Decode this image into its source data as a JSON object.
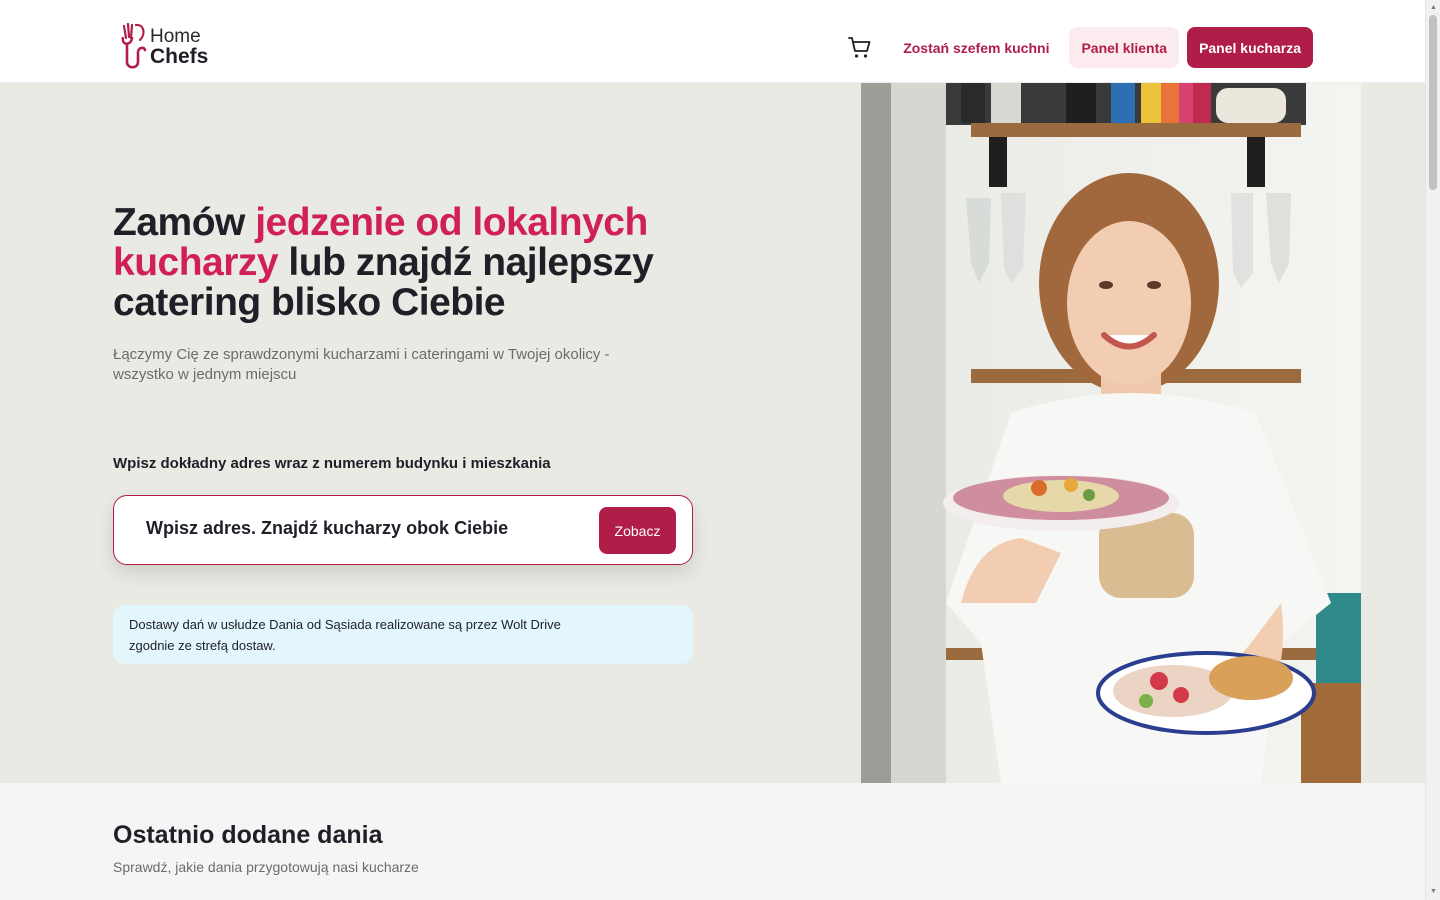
{
  "header": {
    "logo": {
      "line1": "Home",
      "line2": "Chefs"
    },
    "cart_icon": "shopping-cart-icon",
    "become_chef_label": "Zostań szefem kuchni",
    "client_panel_label": "Panel klienta",
    "chef_panel_label": "Panel kucharza"
  },
  "hero": {
    "title_part1": "Zamów ",
    "title_accent": "jedzenie od lokalnych kucharzy",
    "title_part2": " lub znajdź najlepszy catering blisko Ciebie",
    "subtitle": "Łączymy Cię ze sprawdzonymi kucharzami i cateringami w Twojej okolicy - wszystko w jednym miejscu",
    "address_label": "Wpisz dokładny adres wraz z numerem budynku i mieszkania",
    "search_placeholder": "Wpisz adres. Znajdź kucharzy obok Ciebie",
    "search_button": "Zobacz",
    "info_text": "Dostawy dań w usłudze Dania od Sąsiada realizowane są przez Wolt Drive zgodnie ze strefą dostaw."
  },
  "recent_section": {
    "title": "Ostatnio dodane dania",
    "subtitle": "Sprawdź, jakie dania przygotowują nasi kucharze"
  },
  "colors": {
    "brand": "#b01d48",
    "accent": "#d11f5a",
    "hero_bg": "#eaeae4",
    "info_bg": "#e2f6fb"
  }
}
